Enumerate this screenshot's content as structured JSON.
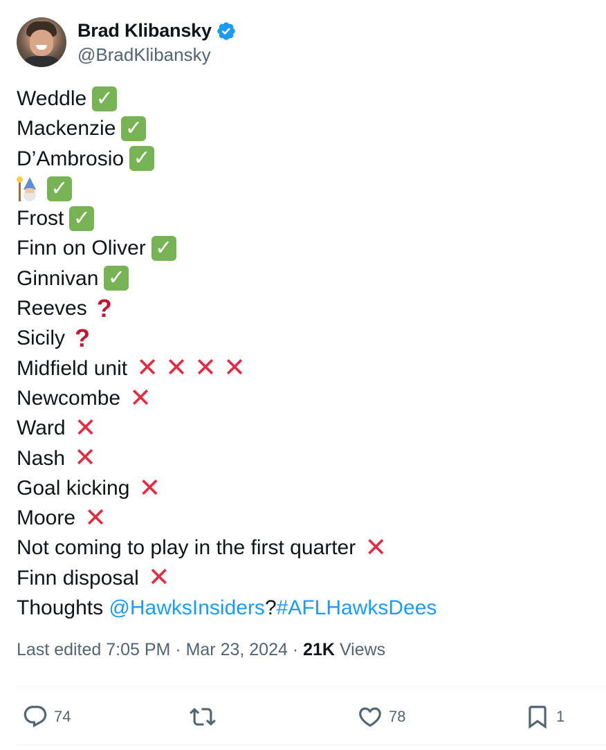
{
  "author": {
    "name": "Brad Klibansky",
    "handle": "@BradKlibansky",
    "verified_color": "#1d9bf0"
  },
  "tweet": {
    "lines": [
      {
        "text": "Weddle",
        "marks": [
          "check"
        ]
      },
      {
        "text": "Mackenzie",
        "marks": [
          "check"
        ]
      },
      {
        "text": "D’Ambrosio",
        "marks": [
          "check"
        ]
      },
      {
        "text": "",
        "emoji": "mage-emoji",
        "marks": [
          "check"
        ]
      },
      {
        "text": "Frost",
        "marks": [
          "check"
        ]
      },
      {
        "text": "Finn on Oliver",
        "marks": [
          "check"
        ]
      },
      {
        "text": "Ginnivan",
        "marks": [
          "check"
        ]
      },
      {
        "text": "Reeves",
        "marks": [
          "question"
        ]
      },
      {
        "text": "Sicily",
        "marks": [
          "question"
        ]
      },
      {
        "text": "Midfield unit",
        "marks": [
          "cross",
          "cross",
          "cross",
          "cross"
        ]
      },
      {
        "text": "Newcombe",
        "marks": [
          "cross"
        ]
      },
      {
        "text": "Ward",
        "marks": [
          "cross"
        ]
      },
      {
        "text": "Nash",
        "marks": [
          "cross"
        ]
      },
      {
        "text": "Goal kicking",
        "marks": [
          "cross"
        ]
      },
      {
        "text": "Moore",
        "marks": [
          "cross"
        ]
      },
      {
        "text": "Not coming to play in the first quarter",
        "marks": [
          "cross"
        ]
      },
      {
        "text": "Finn disposal",
        "marks": [
          "cross"
        ]
      }
    ],
    "last_line": {
      "prefix": "Thoughts ",
      "mention": "@HawksInsiders",
      "separator": "?",
      "hashtag": "#AFLHawksDees"
    }
  },
  "meta": {
    "edited": "Last edited 7:05 PM · Mar 23, 2024 · ",
    "views_count": "21K",
    "views_label": " Views"
  },
  "actions": {
    "replies": "74",
    "likes": "78",
    "bookmarks": "1"
  },
  "colors": {
    "link": "#1d9bf0",
    "check_bg": "#77b255",
    "cross": "#dd2e44",
    "question": "#be1931",
    "muted": "#536471"
  }
}
